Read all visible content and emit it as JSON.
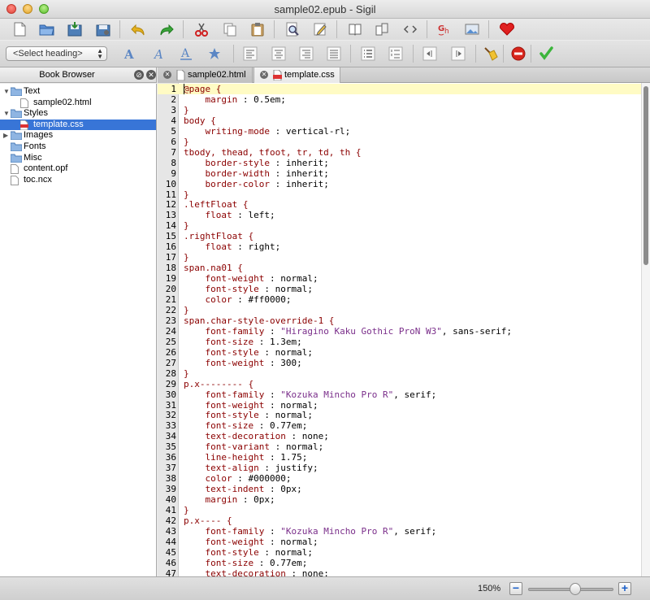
{
  "window": {
    "title": "sample02.epub - Sigil"
  },
  "toolbar_top": {
    "buttons": [
      {
        "name": "new-file-icon"
      },
      {
        "name": "open-folder-icon"
      },
      {
        "name": "save-icon"
      },
      {
        "name": "save-as-icon"
      },
      {
        "name": "undo-icon"
      },
      {
        "name": "redo-icon"
      },
      {
        "name": "cut-icon"
      },
      {
        "name": "copy-icon"
      },
      {
        "name": "paste-icon"
      },
      {
        "name": "find-replace-icon"
      },
      {
        "name": "edit-metadata-icon"
      },
      {
        "name": "book-view-icon"
      },
      {
        "name": "split-view-icon"
      },
      {
        "name": "code-view-icon"
      },
      {
        "name": "spellcheck-icon"
      },
      {
        "name": "insert-image-icon"
      },
      {
        "name": "donate-heart-icon"
      }
    ]
  },
  "toolbar_format": {
    "heading_select": "<Select heading>",
    "buttons": [
      {
        "name": "bold-icon"
      },
      {
        "name": "italic-icon"
      },
      {
        "name": "underline-icon"
      },
      {
        "name": "strikethrough-icon"
      },
      {
        "name": "align-left-icon"
      },
      {
        "name": "align-center-icon"
      },
      {
        "name": "align-right-icon"
      },
      {
        "name": "align-justify-icon"
      },
      {
        "name": "bullet-list-icon"
      },
      {
        "name": "numbered-list-icon"
      },
      {
        "name": "decrease-indent-icon"
      },
      {
        "name": "increase-indent-icon"
      },
      {
        "name": "clean-source-icon"
      },
      {
        "name": "stop-icon"
      },
      {
        "name": "validate-checkmark-icon"
      }
    ]
  },
  "book_browser": {
    "title": "Book Browser",
    "tree": [
      {
        "label": "Text",
        "type": "folder",
        "expanded": true,
        "indent": 0
      },
      {
        "label": "sample02.html",
        "type": "file",
        "indent": 1
      },
      {
        "label": "Styles",
        "type": "folder",
        "expanded": true,
        "indent": 0
      },
      {
        "label": "template.css",
        "type": "css",
        "indent": 1,
        "selected": true
      },
      {
        "label": "Images",
        "type": "folder",
        "expanded": false,
        "indent": 0
      },
      {
        "label": "Fonts",
        "type": "folder",
        "indent": 0
      },
      {
        "label": "Misc",
        "type": "folder",
        "indent": 0
      },
      {
        "label": "content.opf",
        "type": "file",
        "indent": 0
      },
      {
        "label": "toc.ncx",
        "type": "file",
        "indent": 0
      }
    ]
  },
  "tabs": [
    {
      "label": "sample02.html",
      "active": false
    },
    {
      "label": "template.css",
      "active": true
    }
  ],
  "editor": {
    "current_line": 1,
    "lines": [
      [
        [
          "s",
          "@page {"
        ]
      ],
      [
        [
          "p",
          "    margin"
        ],
        [
          "v",
          " : 0.5em;"
        ]
      ],
      [
        [
          "s",
          "}"
        ]
      ],
      [
        [
          "s",
          "body {"
        ]
      ],
      [
        [
          "p",
          "    writing-mode"
        ],
        [
          "v",
          " : vertical-rl;"
        ]
      ],
      [
        [
          "s",
          "}"
        ]
      ],
      [
        [
          "s",
          "tbody, thead, tfoot, tr, td, th {"
        ]
      ],
      [
        [
          "p",
          "    border-style"
        ],
        [
          "v",
          " : inherit;"
        ]
      ],
      [
        [
          "p",
          "    border-width"
        ],
        [
          "v",
          " : inherit;"
        ]
      ],
      [
        [
          "p",
          "    border-color"
        ],
        [
          "v",
          " : inherit;"
        ]
      ],
      [
        [
          "s",
          "}"
        ]
      ],
      [
        [
          "s",
          ".leftFloat {"
        ]
      ],
      [
        [
          "p",
          "    float"
        ],
        [
          "v",
          " : left;"
        ]
      ],
      [
        [
          "s",
          "}"
        ]
      ],
      [
        [
          "s",
          ".rightFloat {"
        ]
      ],
      [
        [
          "p",
          "    float"
        ],
        [
          "v",
          " : right;"
        ]
      ],
      [
        [
          "s",
          "}"
        ]
      ],
      [
        [
          "s",
          "span.na01 {"
        ]
      ],
      [
        [
          "p",
          "    font-weight"
        ],
        [
          "v",
          " : normal;"
        ]
      ],
      [
        [
          "p",
          "    font-style"
        ],
        [
          "v",
          " : normal;"
        ]
      ],
      [
        [
          "p",
          "    color"
        ],
        [
          "v",
          " : #ff0000;"
        ]
      ],
      [
        [
          "s",
          "}"
        ]
      ],
      [
        [
          "s",
          "span.char-style-override-1 {"
        ]
      ],
      [
        [
          "p",
          "    font-family"
        ],
        [
          "v",
          " : "
        ],
        [
          "q",
          "\"Hiragino Kaku Gothic ProN W3\""
        ],
        [
          "v",
          ", sans-serif;"
        ]
      ],
      [
        [
          "p",
          "    font-size"
        ],
        [
          "v",
          " : 1.3em;"
        ]
      ],
      [
        [
          "p",
          "    font-style"
        ],
        [
          "v",
          " : normal;"
        ]
      ],
      [
        [
          "p",
          "    font-weight"
        ],
        [
          "v",
          " : 300;"
        ]
      ],
      [
        [
          "s",
          "}"
        ]
      ],
      [
        [
          "s",
          "p.x-------- {"
        ]
      ],
      [
        [
          "p",
          "    font-family"
        ],
        [
          "v",
          " : "
        ],
        [
          "q",
          "\"Kozuka Mincho Pro R\""
        ],
        [
          "v",
          ", serif;"
        ]
      ],
      [
        [
          "p",
          "    font-weight"
        ],
        [
          "v",
          " : normal;"
        ]
      ],
      [
        [
          "p",
          "    font-style"
        ],
        [
          "v",
          " : normal;"
        ]
      ],
      [
        [
          "p",
          "    font-size"
        ],
        [
          "v",
          " : 0.77em;"
        ]
      ],
      [
        [
          "p",
          "    text-decoration"
        ],
        [
          "v",
          " : none;"
        ]
      ],
      [
        [
          "p",
          "    font-variant"
        ],
        [
          "v",
          " : normal;"
        ]
      ],
      [
        [
          "p",
          "    line-height"
        ],
        [
          "v",
          " : 1.75;"
        ]
      ],
      [
        [
          "p",
          "    text-align"
        ],
        [
          "v",
          " : justify;"
        ]
      ],
      [
        [
          "p",
          "    color"
        ],
        [
          "v",
          " : #000000;"
        ]
      ],
      [
        [
          "p",
          "    text-indent"
        ],
        [
          "v",
          " : 0px;"
        ]
      ],
      [
        [
          "p",
          "    margin"
        ],
        [
          "v",
          " : 0px;"
        ]
      ],
      [
        [
          "s",
          "}"
        ]
      ],
      [
        [
          "s",
          "p.x---- {"
        ]
      ],
      [
        [
          "p",
          "    font-family"
        ],
        [
          "v",
          " : "
        ],
        [
          "q",
          "\"Kozuka Mincho Pro R\""
        ],
        [
          "v",
          ", serif;"
        ]
      ],
      [
        [
          "p",
          "    font-weight"
        ],
        [
          "v",
          " : normal;"
        ]
      ],
      [
        [
          "p",
          "    font-style"
        ],
        [
          "v",
          " : normal;"
        ]
      ],
      [
        [
          "p",
          "    font-size"
        ],
        [
          "v",
          " : 0.77em;"
        ]
      ],
      [
        [
          "p",
          "    text-decoration"
        ],
        [
          "v",
          " : none;"
        ]
      ]
    ]
  },
  "status_bar": {
    "zoom_label": "150%",
    "zoom_level_fraction": 0.56
  }
}
